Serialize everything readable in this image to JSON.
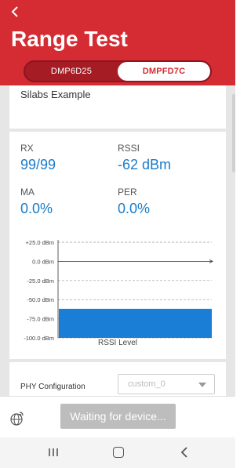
{
  "header": {
    "title": "Range Test",
    "tabs": [
      {
        "label": "DMP6D25",
        "active": false
      },
      {
        "label": "DMPFD7C",
        "active": true
      }
    ]
  },
  "card_top": {
    "text": "Silabs Example"
  },
  "stats": {
    "rx": {
      "label": "RX",
      "value": "99/99"
    },
    "rssi": {
      "label": "RSSI",
      "value": "-62 dBm"
    },
    "ma": {
      "label": "MA",
      "value": "0.0%"
    },
    "per": {
      "label": "PER",
      "value": "0.0%"
    }
  },
  "chart_data": {
    "type": "bar",
    "ticks": [
      "+25.0 dBm",
      "0.0 dBm",
      "-25.0 dBm",
      "-50.0 dBm",
      "-75.0 dBm",
      "-100.0 dBm"
    ],
    "ylim": [
      -100,
      25
    ],
    "values": [
      -62
    ],
    "xlabel": "RSSI Level",
    "bar_color": "#1a7ed6"
  },
  "phy": {
    "label": "PHY Configuration",
    "selected": "custom_0"
  },
  "bottom": {
    "waiting_label": "Waiting for device..."
  },
  "colors": {
    "brand": "#d52b32",
    "accent": "#1a7cc9"
  }
}
